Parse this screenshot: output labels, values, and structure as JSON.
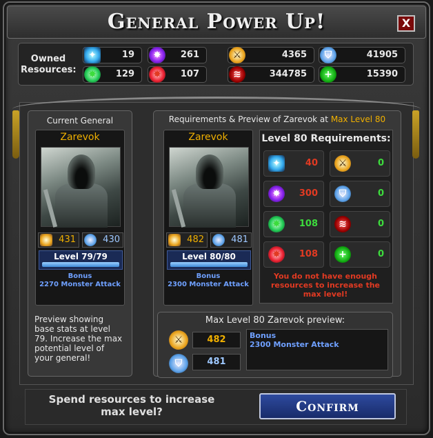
{
  "dialog": {
    "title": "General Power Up!",
    "close_label": "X"
  },
  "owned_resources": {
    "label": "Owned Resources:",
    "items": [
      {
        "icon": "blue-crystal-icon",
        "value": "19"
      },
      {
        "icon": "purple-gem-icon",
        "value": "261"
      },
      {
        "icon": "gold-axe-icon",
        "value": "4365"
      },
      {
        "icon": "shield-icon",
        "value": "41905"
      },
      {
        "icon": "green-gem-icon",
        "value": "129"
      },
      {
        "icon": "red-gem-icon",
        "value": "107"
      },
      {
        "icon": "red-claw-icon",
        "value": "344785"
      },
      {
        "icon": "green-plus-icon",
        "value": "15390"
      }
    ]
  },
  "current_general": {
    "panel_title": "Current General",
    "name": "Zarevok",
    "attack": "431",
    "defense": "430",
    "level_text": "Level 79/79",
    "level_progress": 1.0,
    "bonus_label": "Bonus",
    "bonus_text": "2270 Monster Attack",
    "note": "Preview showing base stats at level 79. Increase the max potential level of your general!"
  },
  "preview": {
    "panel_title_prefix": "Requirements & Preview of Zarevok at ",
    "panel_title_highlight": "Max Level 80",
    "name": "Zarevok",
    "attack": "482",
    "defense": "481",
    "level_text": "Level 80/80",
    "level_progress": 1.0,
    "bonus_label": "Bonus",
    "bonus_text": "2300 Monster Attack"
  },
  "requirements": {
    "title": "Level 80 Requirements:",
    "items": [
      {
        "icon": "blue-crystal-icon",
        "value": "40",
        "status": "insufficient"
      },
      {
        "icon": "gold-axe-icon",
        "value": "0",
        "status": "ok"
      },
      {
        "icon": "purple-gem-icon",
        "value": "300",
        "status": "insufficient"
      },
      {
        "icon": "shield-icon",
        "value": "0",
        "status": "ok"
      },
      {
        "icon": "green-gem-icon",
        "value": "108",
        "status": "ok"
      },
      {
        "icon": "red-claw-icon",
        "value": "0",
        "status": "ok"
      },
      {
        "icon": "red-gem-icon",
        "value": "108",
        "status": "insufficient"
      },
      {
        "icon": "green-plus-icon",
        "value": "0",
        "status": "ok"
      }
    ],
    "warning": "You do not have enough resources to increase the max level!"
  },
  "max_preview": {
    "title": "Max Level 80 Zarevok preview:",
    "attack": "482",
    "defense": "481",
    "bonus_label": "Bonus",
    "bonus_text": "2300 Monster Attack"
  },
  "footer": {
    "prompt": "Spend resources to increase max level?",
    "confirm_label": "Confirm"
  },
  "colors": {
    "gold": "#f0b000",
    "insufficient": "#e23a22",
    "ok": "#3ddc3d",
    "bonus": "#6fa0ff",
    "confirm": "#182b6a"
  }
}
